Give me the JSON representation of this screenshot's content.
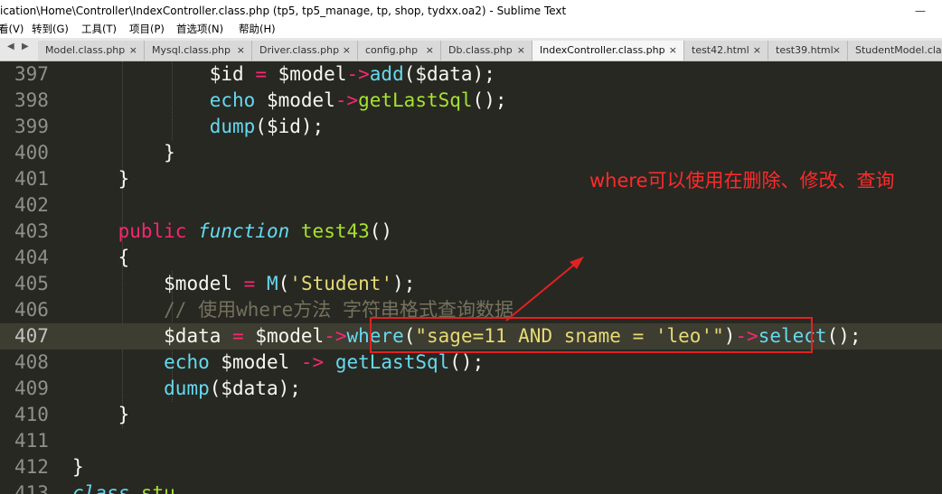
{
  "window": {
    "title": "ication\\Home\\Controller\\IndexController.class.php (tp5, tp5_manage, tp, shop, tydxx.oa2) - Sublime Text",
    "minimize_glyph": "—"
  },
  "menu": [
    "看(V)",
    "转到(G)",
    "工具(T)",
    "项目(P)",
    "首选项(N)",
    "帮助(H)"
  ],
  "tab_nav": {
    "left": "◀",
    "right": "▶"
  },
  "tabs": [
    {
      "label": "Model.class.php",
      "active": false
    },
    {
      "label": "Mysql.class.php",
      "active": false
    },
    {
      "label": "Driver.class.php",
      "active": false
    },
    {
      "label": "config.php",
      "active": false
    },
    {
      "label": "Db.class.php",
      "active": false
    },
    {
      "label": "IndexController.class.php",
      "active": true
    },
    {
      "label": "test42.html",
      "active": false
    },
    {
      "label": "test39.html",
      "active": false
    },
    {
      "label": "StudentModel.class.php",
      "active": false
    }
  ],
  "tab_close_glyph": "×",
  "editor": {
    "current_line": "407",
    "lines": [
      {
        "num": "397",
        "tokens": [
          [
            "            ",
            "gw"
          ],
          [
            "$id",
            "gw"
          ],
          [
            " ",
            "gw"
          ],
          [
            "=",
            "gr"
          ],
          [
            " $model",
            "gw"
          ],
          [
            "->",
            "gr"
          ],
          [
            "add",
            "gb"
          ],
          [
            "($data);",
            "gw"
          ]
        ]
      },
      {
        "num": "398",
        "tokens": [
          [
            "            ",
            "gw"
          ],
          [
            "echo",
            "gb"
          ],
          [
            " $model",
            "gw"
          ],
          [
            "->",
            "gr"
          ],
          [
            "getLastSql",
            "gg"
          ],
          [
            "();",
            "gw"
          ]
        ]
      },
      {
        "num": "399",
        "tokens": [
          [
            "            ",
            "gw"
          ],
          [
            "dump",
            "gb"
          ],
          [
            "($id);",
            "gw"
          ]
        ]
      },
      {
        "num": "400",
        "tokens": [
          [
            "        }",
            "gw"
          ]
        ]
      },
      {
        "num": "401",
        "tokens": [
          [
            "    }",
            "gw"
          ]
        ]
      },
      {
        "num": "402",
        "tokens": []
      },
      {
        "num": "403",
        "tokens": [
          [
            "    ",
            "gw"
          ],
          [
            "public",
            "gr"
          ],
          [
            " ",
            "gw"
          ],
          [
            "function",
            "gi"
          ],
          [
            " ",
            "gw"
          ],
          [
            "test43",
            "gg"
          ],
          [
            "()",
            "gw"
          ]
        ]
      },
      {
        "num": "404",
        "tokens": [
          [
            "    {",
            "gw"
          ]
        ]
      },
      {
        "num": "405",
        "tokens": [
          [
            "        ",
            "gw"
          ],
          [
            "$model",
            "gw"
          ],
          [
            " ",
            "gw"
          ],
          [
            "=",
            "gr"
          ],
          [
            " ",
            "gw"
          ],
          [
            "M",
            "gb"
          ],
          [
            "(",
            "gw"
          ],
          [
            "'Student'",
            "gy"
          ],
          [
            ");",
            "gw"
          ]
        ]
      },
      {
        "num": "406",
        "tokens": [
          [
            "        ",
            "gw"
          ],
          [
            "// 使用where方法 字符串格式查询数据",
            "gc"
          ]
        ]
      },
      {
        "num": "407",
        "tokens": [
          [
            "        ",
            "gw"
          ],
          [
            "$data",
            "gw"
          ],
          [
            " ",
            "gw"
          ],
          [
            "=",
            "gr"
          ],
          [
            " $model",
            "gw"
          ],
          [
            "->",
            "gr"
          ],
          [
            "where",
            "gb"
          ],
          [
            "(",
            "gw"
          ],
          [
            "\"sage=11 AND sname = 'leo'\"",
            "gy"
          ],
          [
            ")",
            "gw"
          ],
          [
            "->",
            "gr"
          ],
          [
            "select",
            "gb"
          ],
          [
            "();",
            "gw"
          ]
        ]
      },
      {
        "num": "408",
        "tokens": [
          [
            "        ",
            "gw"
          ],
          [
            "echo",
            "gb"
          ],
          [
            " $model ",
            "gw"
          ],
          [
            "->",
            "gr"
          ],
          [
            " ",
            "gw"
          ],
          [
            "getLastSql",
            "gb"
          ],
          [
            "();",
            "gw"
          ]
        ]
      },
      {
        "num": "409",
        "tokens": [
          [
            "        ",
            "gw"
          ],
          [
            "dump",
            "gb"
          ],
          [
            "($data);",
            "gw"
          ]
        ]
      },
      {
        "num": "410",
        "tokens": [
          [
            "    }",
            "gw"
          ]
        ]
      },
      {
        "num": "411",
        "tokens": []
      },
      {
        "num": "412",
        "tokens": [
          [
            "}",
            "gw"
          ]
        ]
      },
      {
        "num": "413",
        "tokens": [
          [
            "class",
            "gi"
          ],
          [
            " ",
            "gw"
          ],
          [
            "stu",
            "gg"
          ]
        ]
      }
    ]
  },
  "annotation": {
    "text": "where可以使用在删除、修改、查询",
    "color": "#ff2a2a"
  }
}
